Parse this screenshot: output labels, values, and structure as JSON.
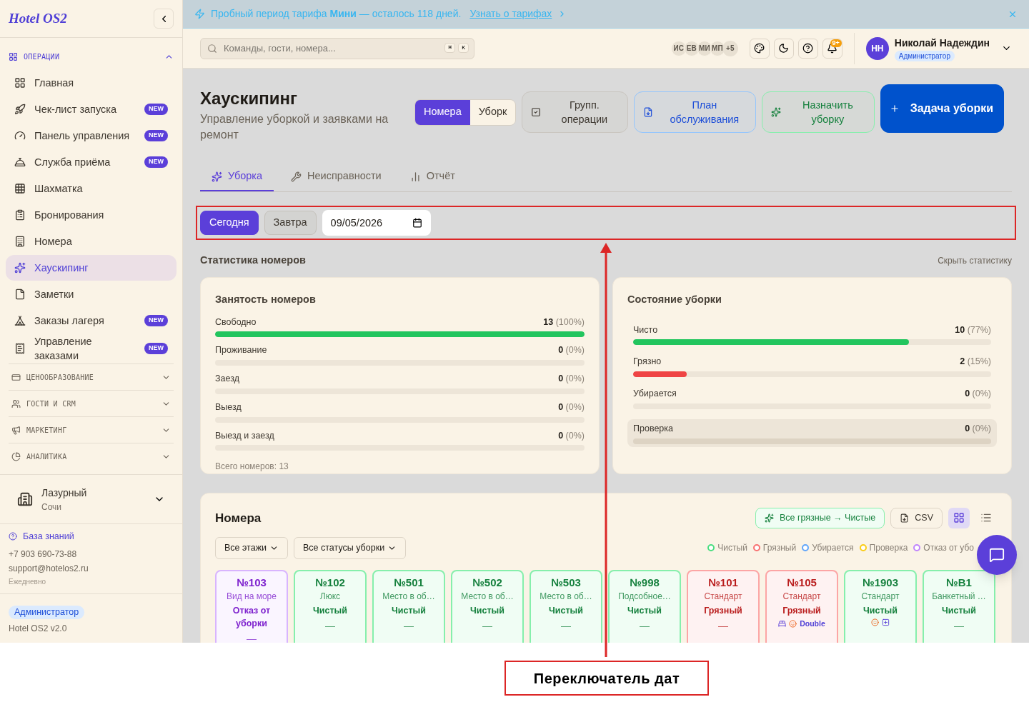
{
  "sidebar": {
    "logo": "Hotel OS2",
    "sections": [
      {
        "label": "ОПЕРАЦИИ",
        "expanded": true,
        "items": [
          {
            "label": "Главная",
            "selected": false
          },
          {
            "label": "Чек-лист запуска",
            "badge": "NEW",
            "selected": false
          },
          {
            "label": "Панель управления",
            "badge": "NEW",
            "selected": false
          },
          {
            "label": "Служба приёма",
            "badge": "NEW",
            "selected": false
          },
          {
            "label": "Шахматка",
            "selected": false
          },
          {
            "label": "Бронирования",
            "selected": false
          },
          {
            "label": "Номера",
            "selected": false
          },
          {
            "label": "Хаускипинг",
            "selected": true
          },
          {
            "label": "Заметки",
            "selected": false
          },
          {
            "label": "Заказы лагеря",
            "badge": "NEW",
            "selected": false
          },
          {
            "label": "Управление заказами",
            "badge": "NEW",
            "selected": false
          }
        ]
      },
      {
        "label": "ЦЕНООБРАЗОВАНИЕ",
        "expanded": false
      },
      {
        "label": "ГОСТИ И CRM",
        "expanded": false
      },
      {
        "label": "МАРКЕТИНГ",
        "expanded": false
      },
      {
        "label": "АНАЛИТИКА",
        "expanded": false
      }
    ],
    "property": {
      "name": "Лазурный",
      "city": "Сочи"
    },
    "help": {
      "link": "База знаний",
      "phone": "+7 903 690-73-88",
      "email": "support@hotelos2.ru",
      "hours": "Ежедневно"
    },
    "role": "Администратор",
    "version": "Hotel OS2 v2.0"
  },
  "banner": {
    "text": "Пробный период тарифа **Мини** — осталось 118 дней.",
    "link": "Узнать о тарифах"
  },
  "header": {
    "search_placeholder": "Команды, гости, номера...",
    "keys": [
      "⌘",
      "K"
    ],
    "avatars": [
      "ИС",
      "ЕВ",
      "МИ",
      "МП"
    ],
    "more": "+5",
    "notifications": "9+",
    "user": {
      "initials": "НН",
      "name": "Николай Надеждин",
      "role": "Администратор"
    }
  },
  "page": {
    "title": "Хаускипинг",
    "subtitle": "Управление уборкой и заявками на ремонт",
    "view_toggle": [
      {
        "label": "Номера",
        "selected": true
      },
      {
        "label": "Уборк",
        "selected": false
      }
    ],
    "actions": [
      {
        "label": "Групп. операции",
        "kind": "neutral"
      },
      {
        "label": "План обслуживания",
        "kind": "blue"
      },
      {
        "label": "Назначить уборку",
        "kind": "green"
      },
      {
        "label": "Задача уборки",
        "kind": "primary"
      }
    ],
    "tabs": [
      {
        "label": "Уборка",
        "selected": true
      },
      {
        "label": "Неисправности",
        "selected": false
      },
      {
        "label": "Отчёт",
        "selected": false
      }
    ],
    "date_switcher": {
      "buttons": [
        {
          "label": "Сегодня",
          "selected": true
        },
        {
          "label": "Завтра",
          "selected": false
        }
      ],
      "date": "09/05/2026"
    }
  },
  "stats": {
    "title": "Статистика номеров",
    "hide_link": "Скрыть статистику",
    "occupancy": {
      "title": "Занятость номеров",
      "rows": [
        {
          "label": "Свободно",
          "count": "13",
          "percent": "(100%)",
          "level": 1
        },
        {
          "label": "Проживание",
          "count": "0",
          "percent": "(0%)"
        },
        {
          "label": "Заезд",
          "count": "0",
          "percent": "(0%)"
        },
        {
          "label": "Выезд",
          "count": "0",
          "percent": "(0%)"
        },
        {
          "label": "Выезд и заезд",
          "count": "0",
          "percent": "(0%)"
        }
      ],
      "total": "Всего номеров: 13"
    },
    "cleaning": {
      "title": "Состояние уборки",
      "rows": [
        {
          "label": "Чисто",
          "count": "10",
          "percent": "(77%)",
          "level": 0.77,
          "color": "#22c55e",
          "highlighted": false
        },
        {
          "label": "Грязно",
          "count": "2",
          "percent": "(15%)",
          "level": 0.15,
          "color": "#ef4444",
          "highlighted": false
        },
        {
          "label": "Убирается",
          "count": "0",
          "percent": "(0%)",
          "highlighted": false
        },
        {
          "label": "Проверка",
          "count": "0",
          "percent": "(0%)",
          "highlighted": true
        }
      ]
    }
  },
  "rooms": {
    "title": "Номера",
    "bulk_button": "Все грязные → Чистые",
    "csv_button": "CSV",
    "view_modes": [
      {
        "kind": "grid",
        "selected": true
      },
      {
        "kind": "list",
        "selected": false
      }
    ],
    "filters": [
      "Все этажи",
      "Все статусы уборки"
    ],
    "legend": [
      {
        "label": "Чистый",
        "color": "#4ade80"
      },
      {
        "label": "Грязный",
        "color": "#f87171"
      },
      {
        "label": "Убирается",
        "color": "#60a5fa"
      },
      {
        "label": "Проверка",
        "color": "#facc15"
      },
      {
        "label": "Отказ от убо",
        "color": "#c084fc"
      }
    ],
    "cards": [
      {
        "number": "№103",
        "type": "Вид на море",
        "status": "Отказ от уборки",
        "kind": "refused",
        "note": "—"
      },
      {
        "number": "№102",
        "type": "Люкс",
        "status": "Чистый",
        "kind": "clean",
        "note": "—"
      },
      {
        "number": "№501",
        "type": "Место в об…",
        "status": "Чистый",
        "kind": "clean",
        "note": "—"
      },
      {
        "number": "№502",
        "type": "Место в об…",
        "status": "Чистый",
        "kind": "clean",
        "note": "—"
      },
      {
        "number": "№503",
        "type": "Место в об…",
        "status": "Чистый",
        "kind": "clean",
        "note": "—"
      },
      {
        "number": "№998",
        "type": "Подсобное…",
        "status": "Чистый",
        "kind": "clean",
        "note": "—"
      },
      {
        "number": "№101",
        "type": "Стандарт",
        "status": "Грязный",
        "kind": "dirty",
        "note": "—"
      },
      {
        "number": "№105",
        "type": "Стандарт",
        "status": "Грязный",
        "kind": "dirty",
        "markers": [
          {
            "kind": "bed"
          },
          {
            "kind": "pet"
          }
        ],
        "tag": "Double"
      },
      {
        "number": "№1903",
        "type": "Стандарт",
        "status": "Чистый",
        "kind": "clean",
        "markers": [
          {
            "kind": "pet"
          },
          {
            "kind": "extra"
          }
        ]
      },
      {
        "number": "№B1",
        "type": "Банкетный …",
        "status": "Чистый",
        "kind": "clean",
        "note": "—"
      }
    ]
  },
  "annotation": {
    "label": "Переключатель дат"
  }
}
